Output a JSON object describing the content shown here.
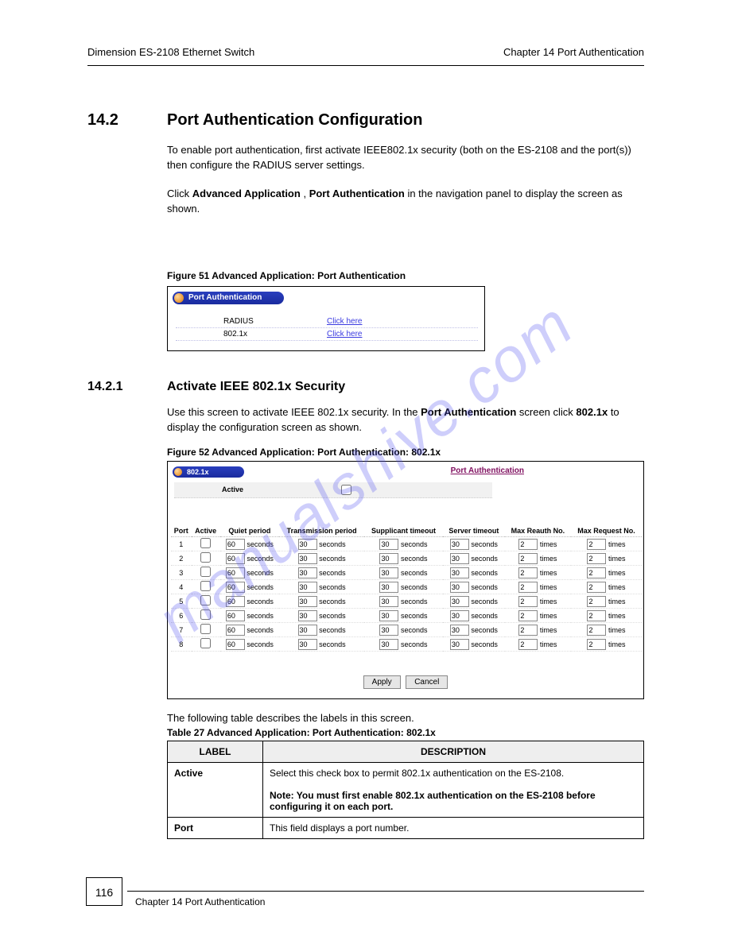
{
  "header": {
    "left": "Dimension ES-2108 Ethernet Switch",
    "right": "Chapter 14 Port Authentication"
  },
  "sec": {
    "num": "14.2",
    "title": "Port Authentication Configuration"
  },
  "intro": "To enable port authentication, first activate IEEE802.1x security (both on the ES-2108 and the port(s)) then configure the RADIUS server settings.",
  "clickline": {
    "pre": "Click ",
    "bold": "Advanced Application",
    "mid": ", ",
    "bold2": "Port Authentication",
    "post": " in the navigation panel to display the screen as shown."
  },
  "fig1": {
    "cap": "Figure 51   Advanced Application: Port Authentication",
    "pill": "Port Authentication",
    "rows": [
      {
        "label": "RADIUS",
        "link": "Click here"
      },
      {
        "label": "802.1x",
        "link": "Click here"
      }
    ]
  },
  "sub": {
    "num": "14.2.1",
    "title": "Activate IEEE 802.1x Security"
  },
  "subpara": {
    "pre": "Use this screen to activate IEEE 802.1x security. In the ",
    "b1": "Port Authentication",
    "mid": " screen click ",
    "b2": "802.1x",
    "post": " to display the configuration screen as shown."
  },
  "fig2": {
    "cap": "Figure 52   Advanced Application: Port Authentication: 802.1x",
    "pill": "802.1x",
    "crumb": "Port Authentication",
    "active_label": "Active",
    "headers": [
      "Port",
      "Active",
      "Quiet period",
      "Transmission period",
      "Supplicant timeout",
      "Server timeout",
      "Max Reauth No.",
      "Max Request No."
    ],
    "unit_sec": "seconds",
    "unit_tim": "times",
    "rows": [
      {
        "port": "1",
        "quiet": "60",
        "trans": "30",
        "supp": "30",
        "serv": "30",
        "reauth": "2",
        "req": "2"
      },
      {
        "port": "2",
        "quiet": "60",
        "trans": "30",
        "supp": "30",
        "serv": "30",
        "reauth": "2",
        "req": "2"
      },
      {
        "port": "3",
        "quiet": "60",
        "trans": "30",
        "supp": "30",
        "serv": "30",
        "reauth": "2",
        "req": "2"
      },
      {
        "port": "4",
        "quiet": "60",
        "trans": "30",
        "supp": "30",
        "serv": "30",
        "reauth": "2",
        "req": "2"
      },
      {
        "port": "5",
        "quiet": "60",
        "trans": "30",
        "supp": "30",
        "serv": "30",
        "reauth": "2",
        "req": "2"
      },
      {
        "port": "6",
        "quiet": "60",
        "trans": "30",
        "supp": "30",
        "serv": "30",
        "reauth": "2",
        "req": "2"
      },
      {
        "port": "7",
        "quiet": "60",
        "trans": "30",
        "supp": "30",
        "serv": "30",
        "reauth": "2",
        "req": "2"
      },
      {
        "port": "8",
        "quiet": "60",
        "trans": "30",
        "supp": "30",
        "serv": "30",
        "reauth": "2",
        "req": "2"
      }
    ],
    "apply": "Apply",
    "cancel": "Cancel"
  },
  "dtable": {
    "title": "The following table describes the labels in this screen.",
    "cap": "Table 27   Advanced Application: Port Authentication: 802.1x",
    "h1": "LABEL",
    "h2": "DESCRIPTION",
    "rows": [
      {
        "k": "Active",
        "v": "Select this check box to permit 802.1x authentication on the ES-2108.",
        "note": "Note: You must first enable 802.1x authentication on the ES-2108 before configuring it on each port."
      },
      {
        "k": "Port",
        "v": "This field displays a port number."
      }
    ]
  },
  "footer": {
    "page": "116",
    "text": "Chapter 14 Port Authentication"
  },
  "watermark": "manualshive.com"
}
